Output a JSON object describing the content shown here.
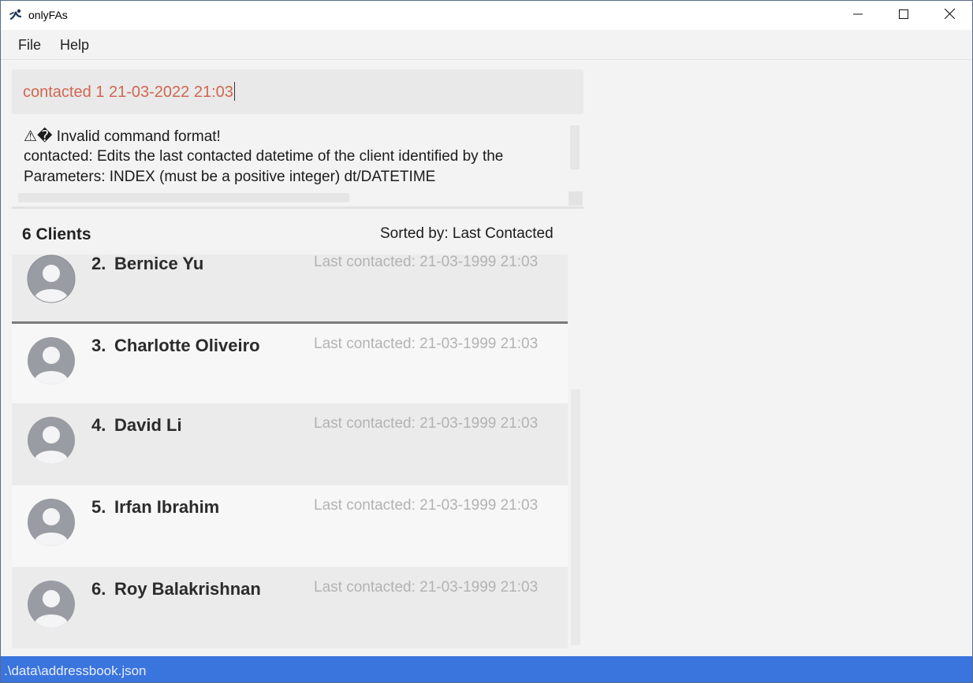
{
  "window": {
    "title": "onlyFAs"
  },
  "menu": {
    "file": "File",
    "help": "Help"
  },
  "command": {
    "value": "contacted 1 21-03-2022 21:03"
  },
  "result": {
    "line1": "⚠� Invalid command format!",
    "line2": "contacted: Edits the last contacted datetime of the client identified by the",
    "line3": "Parameters: INDEX (must be a positive integer) dt/DATETIME"
  },
  "list": {
    "count_label": "6 Clients",
    "sort_label": "Sorted by: Last Contacted",
    "clients": [
      {
        "index": "2.",
        "name": "Bernice Yu",
        "last_contacted": "Last contacted: 21-03-1999 21:03"
      },
      {
        "index": "3.",
        "name": "Charlotte Oliveiro",
        "last_contacted": "Last contacted: 21-03-1999 21:03"
      },
      {
        "index": "4.",
        "name": "David Li",
        "last_contacted": "Last contacted: 21-03-1999 21:03"
      },
      {
        "index": "5.",
        "name": "Irfan Ibrahim",
        "last_contacted": "Last contacted: 21-03-1999 21:03"
      },
      {
        "index": "6.",
        "name": "Roy Balakrishnan",
        "last_contacted": "Last contacted: 21-03-1999 21:03"
      }
    ]
  },
  "status": {
    "path": ".\\data\\addressbook.json"
  },
  "colors": {
    "command_text": "#d06651",
    "status_bar": "#3a74dd",
    "card_dark": "#ebebeb",
    "card_light": "#f7f7f7"
  },
  "icons": {
    "app": "app-logo-icon",
    "minimize": "minimize-icon",
    "maximize": "maximize-icon",
    "close": "close-icon",
    "avatar": "user-avatar-icon"
  }
}
